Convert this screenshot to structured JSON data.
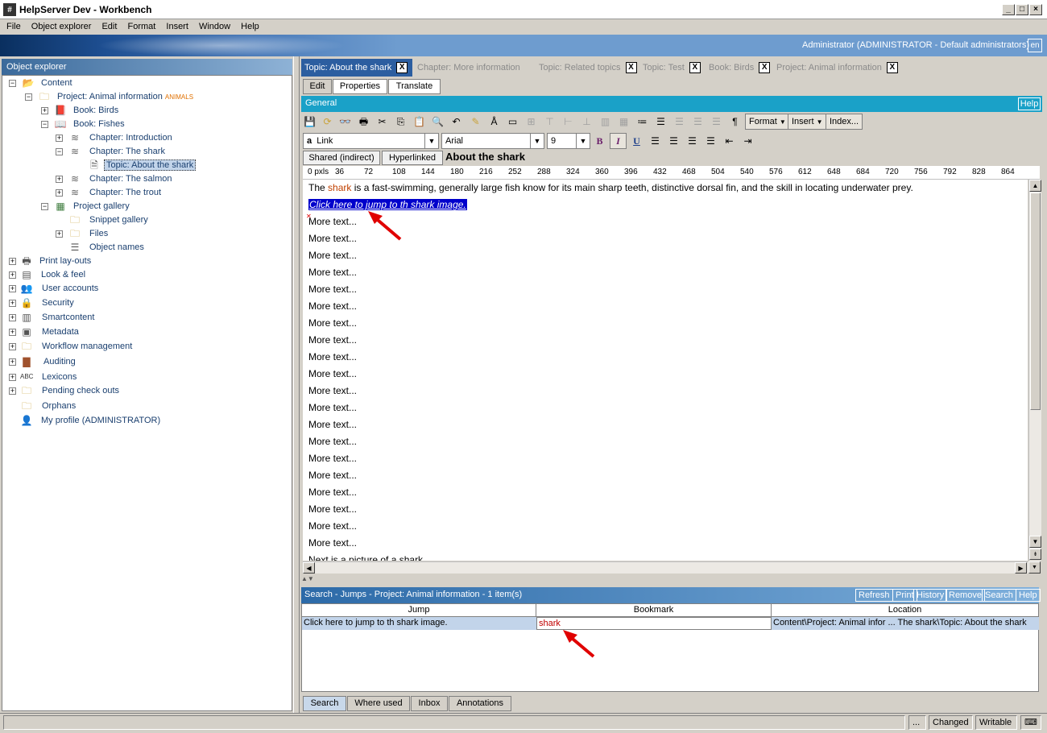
{
  "window": {
    "title": "HelpServer Dev - Workbench",
    "icon_glyph": "#"
  },
  "menu": [
    "File",
    "Object explorer",
    "Edit",
    "Format",
    "Insert",
    "Window",
    "Help"
  ],
  "banner": {
    "user": "Administrator (ADMINISTRATOR - Default administrators)",
    "lang": "en"
  },
  "explorer": {
    "title": "Object explorer",
    "tree": [
      {
        "label": "Content",
        "icon": "folder-icon"
      },
      {
        "label": "Project: Animal information",
        "tag": "ANIMALS",
        "icon": "project-icon"
      },
      {
        "label": "Book: Birds",
        "icon": "book-icon"
      },
      {
        "label": "Book: Fishes",
        "icon": "open-book-icon"
      },
      {
        "label": "Chapter: Introduction",
        "icon": "chapter-icon"
      },
      {
        "label": "Chapter: The shark",
        "icon": "chapter-icon"
      },
      {
        "label": "Topic: About the shark",
        "icon": "topic-icon"
      },
      {
        "label": "Chapter: The salmon",
        "icon": "chapter-icon"
      },
      {
        "label": "Chapter: The trout",
        "icon": "chapter-icon"
      },
      {
        "label": "Project gallery",
        "icon": "gallery-icon"
      },
      {
        "label": "Snippet gallery",
        "icon": "folder-icon"
      },
      {
        "label": "Files",
        "icon": "folder-icon"
      },
      {
        "label": "Object names",
        "icon": "list-icon"
      },
      {
        "label": "Print lay-outs",
        "icon": "printer-icon"
      },
      {
        "label": "Look & feel",
        "icon": "monitor-icon"
      },
      {
        "label": "User accounts",
        "icon": "users-icon"
      },
      {
        "label": "Security",
        "icon": "lock-icon"
      },
      {
        "label": "Smartcontent",
        "icon": "smart-icon"
      },
      {
        "label": "Metadata",
        "icon": "metadata-icon"
      },
      {
        "label": "Workflow management",
        "icon": "workflow-icon"
      },
      {
        "label": "Auditing",
        "icon": "chart-icon"
      },
      {
        "label": "Lexicons",
        "icon": "abc-icon"
      },
      {
        "label": "Pending check outs",
        "icon": "checkout-icon"
      },
      {
        "label": "Orphans",
        "icon": "orphan-icon"
      },
      {
        "label": "My profile (ADMINISTRATOR)",
        "icon": "user-icon"
      }
    ]
  },
  "doc_tabs": [
    {
      "label": "Topic: About the shark",
      "close": "X"
    },
    {
      "label": "Chapter: More information",
      "close": "X"
    },
    {
      "label": "Topic: Related topics",
      "close": "X"
    },
    {
      "label": "Topic: Test",
      "close": "X"
    },
    {
      "label": "Book: Birds",
      "close": "X"
    },
    {
      "label": "Project: Animal information",
      "close": "X"
    }
  ],
  "sub_tabs": [
    "Edit",
    "Properties",
    "Translate"
  ],
  "general": {
    "title": "General",
    "help": "Help"
  },
  "toolbar": {
    "format_label": "Format",
    "insert_label": "Insert",
    "index_label": "Index...",
    "bold": "B",
    "italic": "I",
    "underline": "U",
    "pilcrow": "¶"
  },
  "format_bar": {
    "style": "Link",
    "style_glyph": "a",
    "font": "Arial",
    "size": "9"
  },
  "doc": {
    "tabs": [
      "Shared (indirect)",
      "Hyperlinked"
    ],
    "heading": "About the shark",
    "ruler": [
      "0 pxls",
      "36",
      "72",
      "108",
      "144",
      "180",
      "216",
      "252",
      "288",
      "324",
      "360",
      "396",
      "432",
      "468",
      "504",
      "540",
      "576",
      "612",
      "648",
      "684",
      "720",
      "756",
      "792",
      "828",
      "864"
    ],
    "para1_pre": "The ",
    "para1_link": "shark",
    "para1_post": " is a fast-swimming, generally large fish know for its main sharp teeth, distinctive dorsal fin, and the skill in locating underwater prey.",
    "jump_text": "Click here to jump to th shark image.",
    "more_text": "More text...",
    "last_line": "Next is a picture of a shark."
  },
  "search": {
    "title": "Search - Jumps - Project: Animal information - 1 item(s)",
    "buttons": [
      "Refresh",
      "Print",
      "History",
      "Remove",
      "Search",
      "Help"
    ],
    "columns": [
      "Jump",
      "Bookmark",
      "Location"
    ],
    "rows": [
      {
        "jump": "Click here to jump to th shark image.",
        "bookmark": "shark",
        "location": "Content\\Project: Animal infor ...  The shark\\Topic: About the shark"
      }
    ]
  },
  "bottom_tabs": [
    "Search",
    "Where used",
    "Inbox",
    "Annotations"
  ],
  "status": {
    "dots": "...",
    "changed": "Changed",
    "writable": "Writable"
  },
  "colors": {
    "banner": "#1e4f92",
    "general_bar": "#1aa1c8",
    "link": "#c04000",
    "selection": "#0000cc",
    "annotation_arrow": "#e00000"
  }
}
